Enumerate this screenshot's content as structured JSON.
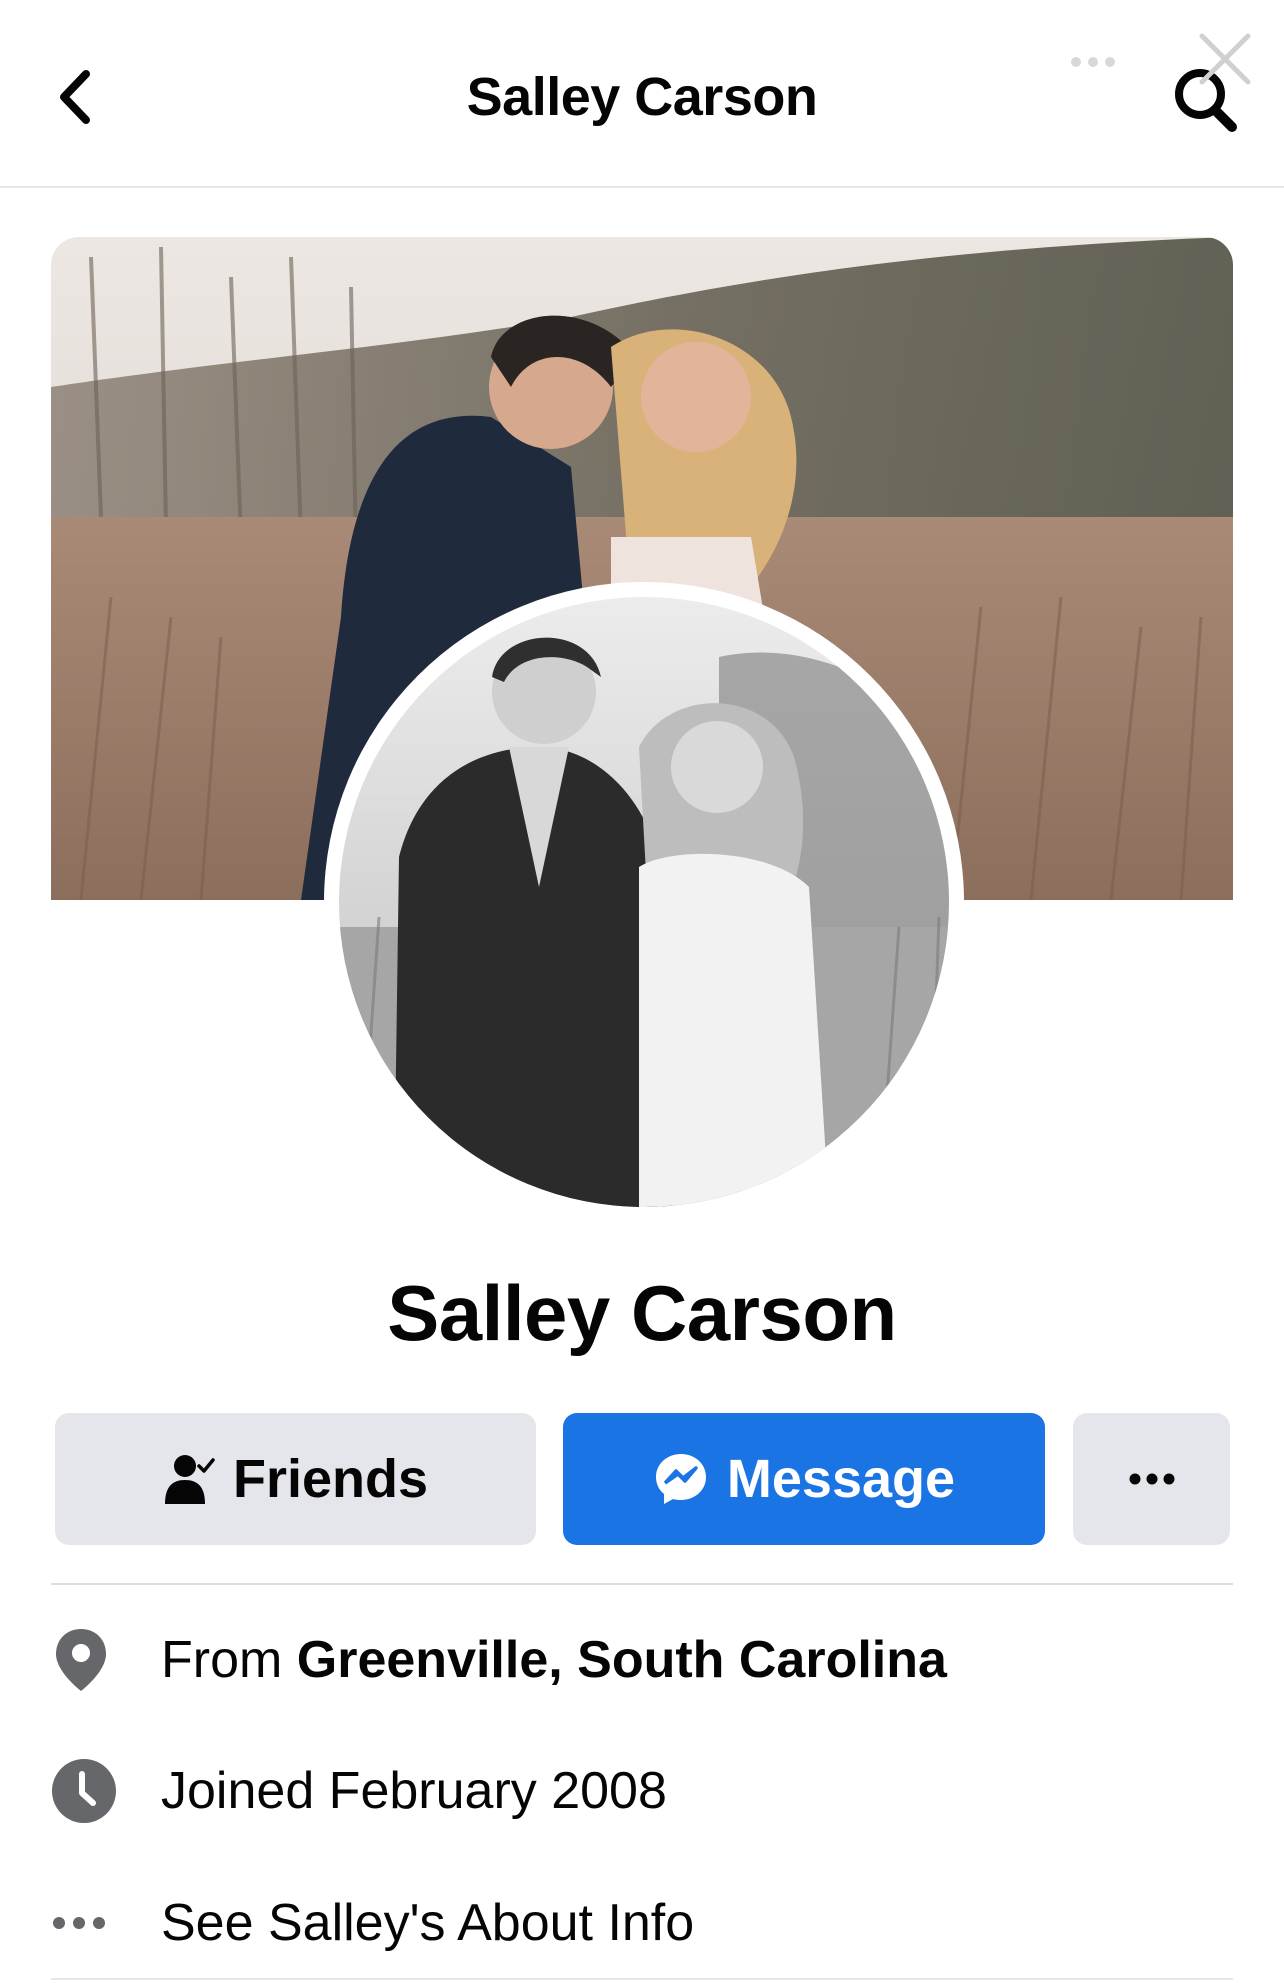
{
  "header": {
    "title": "Salley Carson",
    "back_icon": "chevron-left-icon",
    "search_icon": "search-icon"
  },
  "viewer": {
    "close_icon": "close-icon",
    "more_icon": "more-dots-icon"
  },
  "profile": {
    "name": "Salley Carson",
    "cover_photo": "couple-in-field-cover-photo",
    "profile_photo": "black-and-white-couple-profile-photo"
  },
  "actions": {
    "friends_label": "Friends",
    "message_label": "Message",
    "more_icon": "more-dots-icon"
  },
  "intro": {
    "from_prefix": "From",
    "from_place": "Greenville, South Carolina",
    "joined_text": "Joined February 2008",
    "about_link": "See Salley's About Info"
  },
  "colors": {
    "accent": "#1b74e4",
    "button_gray": "#e4e6eb",
    "icon_gray": "#65676b",
    "text": "#050505"
  }
}
